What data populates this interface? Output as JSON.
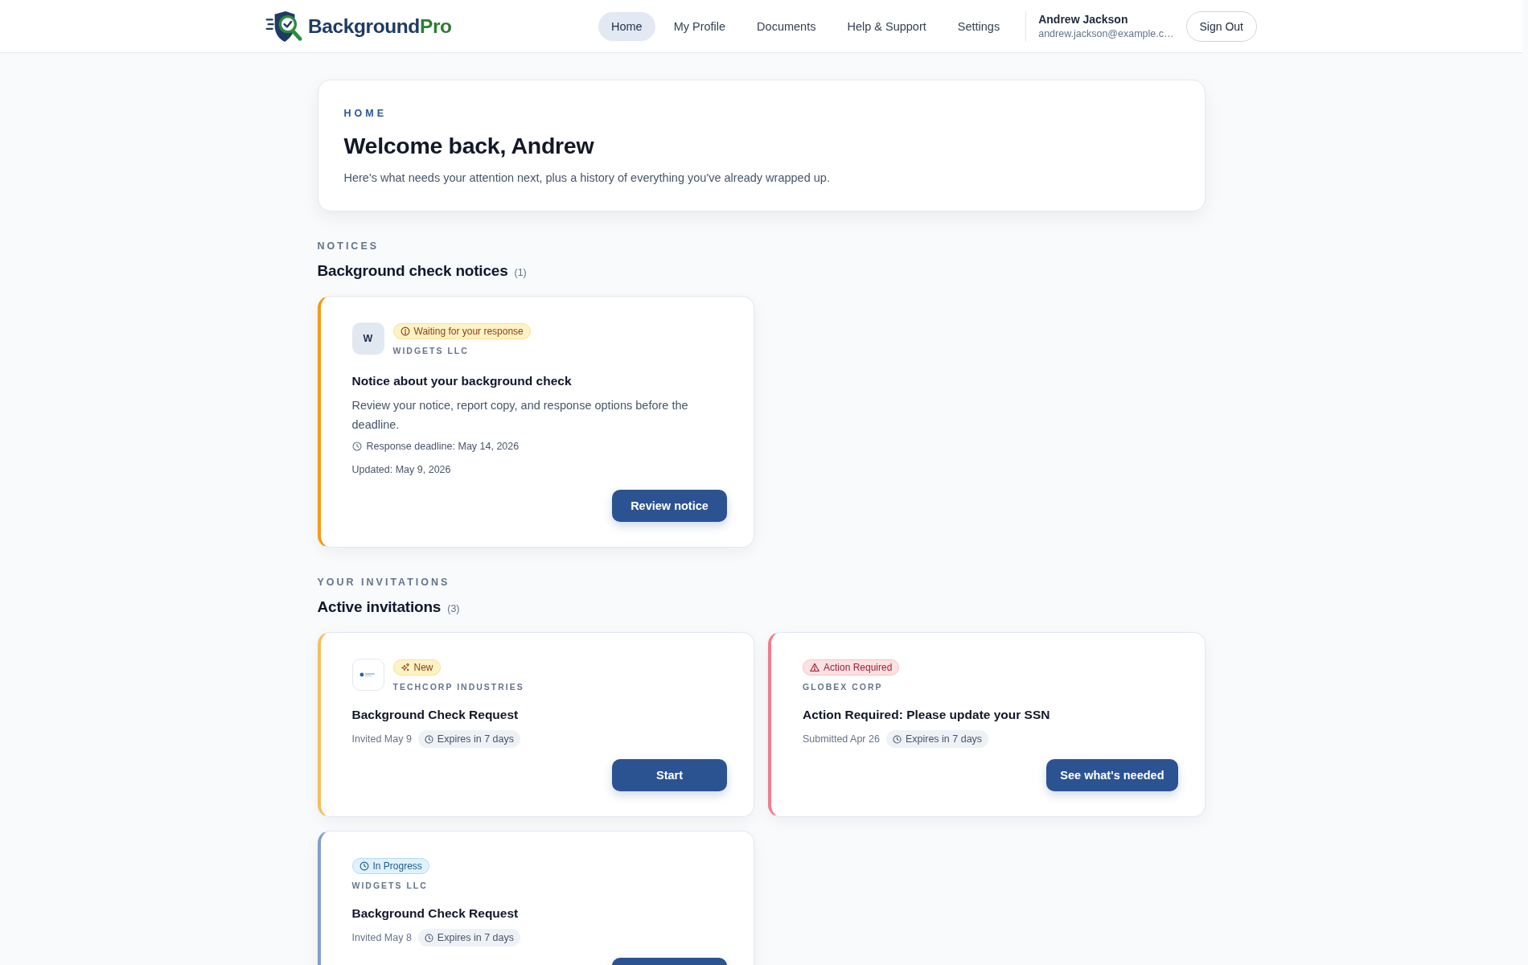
{
  "header": {
    "logo": {
      "text": "Background",
      "accent": "Pro"
    },
    "nav": [
      {
        "label": "Home",
        "selected": true
      },
      {
        "label": "My Profile",
        "selected": false
      },
      {
        "label": "Documents",
        "selected": false
      },
      {
        "label": "Help & Support",
        "selected": false
      },
      {
        "label": "Settings",
        "selected": false
      }
    ],
    "user": {
      "name": "Andrew Jackson",
      "email": "andrew.jackson@example.c…"
    },
    "sign_out": "Sign Out"
  },
  "welcome": {
    "eyebrow": "HOME",
    "title": "Welcome back, Andrew",
    "subtitle": "Here's what needs your attention next, plus a history of everything you've already wrapped up."
  },
  "notices": {
    "eyebrow": "NOTICES",
    "title": "Background check notices",
    "count": "(1)",
    "items": [
      {
        "status": {
          "kind": "waiting",
          "label": "Waiting for your response"
        },
        "avatar": {
          "kind": "initial",
          "text": "W"
        },
        "company": "WIDGETS LLC",
        "title": "Notice about your background check",
        "description": "Review your notice, report copy, and response options before the deadline.",
        "deadline": "Response deadline: May 14, 2026",
        "updated": "Updated: May 9, 2026",
        "action": "Review notice"
      }
    ]
  },
  "invitations": {
    "eyebrow": "YOUR INVITATIONS",
    "title": "Active invitations",
    "count": "(3)",
    "items": [
      {
        "status": {
          "kind": "new",
          "label": "New"
        },
        "avatar": {
          "kind": "logo"
        },
        "company": "TECHCORP INDUSTRIES",
        "title": "Background Check Request",
        "date": "Invited May 9",
        "expires": "Expires in 7 days",
        "action": "Start"
      },
      {
        "status": {
          "kind": "action_required",
          "label": "Action Required"
        },
        "company": "GLOBEX CORP",
        "title": "Action Required: Please update your SSN",
        "date": "Submitted Apr 26",
        "expires": "Expires in 7 days",
        "action": "See what's needed"
      },
      {
        "status": {
          "kind": "in_progress",
          "label": "In Progress"
        },
        "company": "WIDGETS LLC",
        "title": "Background Check Request",
        "date": "Invited May 8",
        "expires": "Expires in 7 days"
      }
    ]
  }
}
